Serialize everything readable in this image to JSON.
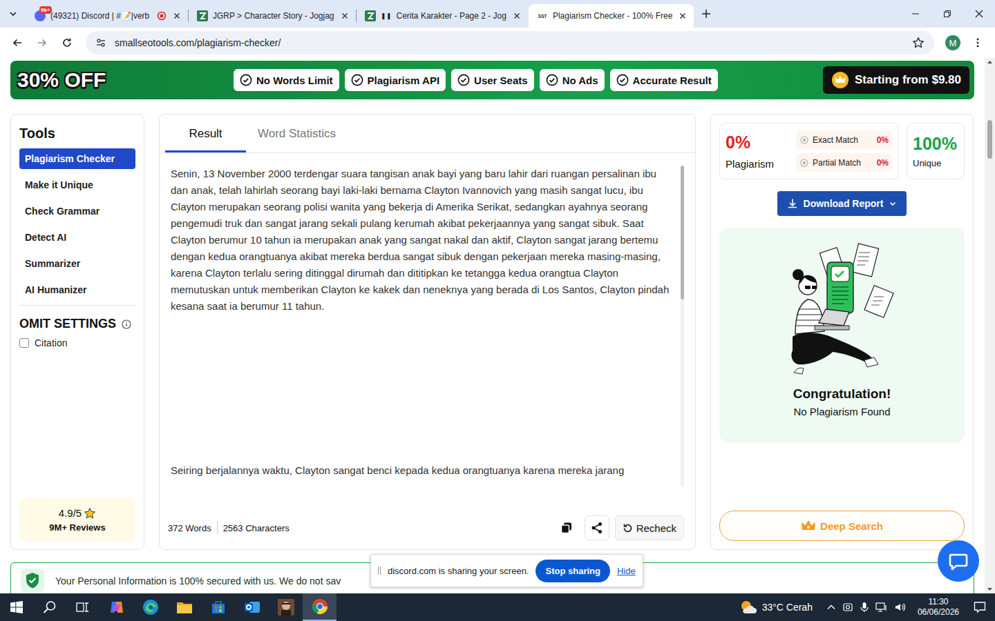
{
  "browser": {
    "tabs": [
      {
        "label": "(49321) Discord | #📝|verb",
        "kind": "discord",
        "badge": "9k+",
        "recording": true,
        "selected": false
      },
      {
        "label": "JGRP > Character Story - Jogjag",
        "kind": "jgrp",
        "recording": false,
        "selected": false
      },
      {
        "label": "Cerita Karakter - Page 2 - Jog",
        "kind": "jgrp",
        "indicator": "❚❚",
        "recording": false,
        "selected": false
      },
      {
        "label": "Plagiarism Checker - 100% Free",
        "kind": "sst",
        "favicon_text": "SST",
        "recording": false,
        "selected": true
      }
    ],
    "url": "smallseotools.com/plagiarism-checker/",
    "profile": "M"
  },
  "banner": {
    "discount": "30% OFF",
    "features": [
      "No Words Limit",
      "Plagiarism API",
      "User Seats",
      "No Ads",
      "Accurate Result"
    ],
    "price_button": "Starting from $9.80"
  },
  "sidebar": {
    "title": "Tools",
    "items": [
      {
        "label": "Plagiarism Checker",
        "selected": true
      },
      {
        "label": "Make it Unique",
        "selected": false
      },
      {
        "label": "Check Grammar",
        "selected": false
      },
      {
        "label": "Detect AI",
        "selected": false
      },
      {
        "label": "Summarizer",
        "selected": false
      },
      {
        "label": "AI Humanizer",
        "selected": false
      }
    ],
    "omit_title": "OMIT SETTINGS",
    "options": [
      {
        "label": "Citation",
        "checked": false
      }
    ],
    "rating": "4.9/5",
    "reviews": "9M+ Reviews"
  },
  "editor": {
    "tabs": [
      {
        "label": "Result",
        "selected": true
      },
      {
        "label": "Word Statistics",
        "selected": false
      }
    ],
    "paragraphs": [
      "Senin, 13 November 2000 terdengar suara tangisan anak bayi yang baru lahir dari ruangan persalinan ibu dan anak, telah lahirlah seorang bayi laki-laki bernama Clayton Ivannovich yang masih sangat lucu, ibu Clayton merupakan seorang polisi wanita yang bekerja di Amerika Serikat, sedangkan ayahnya seorang pengemudi truk dan sangat jarang sekali pulang kerumah akibat pekerjaannya yang sangat sibuk. Saat Clayton berumur 10 tahun ia merupakan anak yang sangat nakal dan aktif, Clayton sangat jarang bertemu dengan kedua orangtuanya akibat mereka berdua sangat sibuk dengan pekerjaan mereka masing-masing, karena Clayton terlalu sering ditinggal dirumah dan dititipkan ke tetangga kedua orangtua Clayton memutuskan untuk memberikan Clayton ke kakek dan neneknya yang berada di Los Santos, Clayton pindah kesana saat ia berumur 11 tahun.",
      "Seiring berjalannya waktu, Clayton sangat benci kepada kedua orangtuanya karena mereka jarang"
    ],
    "words": "372 Words",
    "characters": "2563 Characters",
    "recheck": "Recheck"
  },
  "summary": {
    "plagiarism": "0%",
    "plagiarism_label": "Plagiarism",
    "matches": [
      {
        "label": "Exact Match",
        "value": "0%"
      },
      {
        "label": "Partial Match",
        "value": "0%"
      }
    ],
    "unique": "100%",
    "unique_label": "Unique",
    "download": "Download Report",
    "title": "Congratulation!",
    "message": "No Plagiarism Found",
    "deep_search": "Deep Search"
  },
  "notice": "Your Personal Information is 100% secured with us. We do not sav",
  "share_bar": {
    "message": "discord.com is sharing your screen.",
    "stop": "Stop sharing",
    "hide": "Hide"
  },
  "taskbar": {
    "apps": [
      {
        "kind": "copilot",
        "selected": false
      },
      {
        "kind": "edge",
        "selected": false
      },
      {
        "kind": "explorer",
        "selected": false
      },
      {
        "kind": "store",
        "selected": false
      },
      {
        "kind": "outlook",
        "selected": false
      },
      {
        "kind": "game",
        "selected": false
      },
      {
        "kind": "chrome",
        "selected": true
      }
    ],
    "weather": "33°C Cerah",
    "time": "11:30",
    "date": "06/06/2026"
  }
}
